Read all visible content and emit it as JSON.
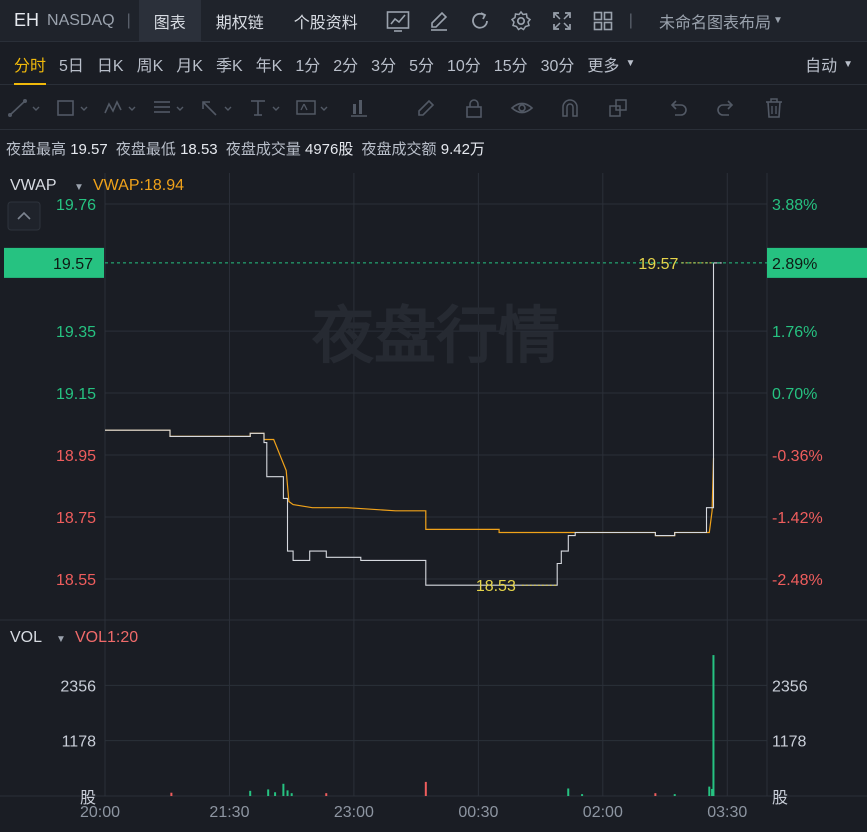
{
  "header": {
    "ticker": "EH",
    "exchange": "NASDAQ",
    "tabs": [
      "图表",
      "期权链",
      "个股资料"
    ],
    "layout_label": "未命名图表布局",
    "icons": [
      "indicator-icon",
      "draw-icon",
      "refresh-icon",
      "settings-icon",
      "fullscreen-icon",
      "grid-layout-icon"
    ]
  },
  "periods": {
    "items": [
      "分时",
      "5日",
      "日K",
      "周K",
      "月K",
      "季K",
      "年K",
      "1分",
      "2分",
      "3分",
      "5分",
      "10分",
      "15分",
      "30分"
    ],
    "more": "更多",
    "auto": "自动",
    "active": "分时"
  },
  "info": {
    "high_label": "夜盘最高",
    "high": "19.57",
    "low_label": "夜盘最低",
    "low": "18.53",
    "vol_label": "夜盘成交量",
    "vol": "4976股",
    "amt_label": "夜盘成交额",
    "amt": "9.42万"
  },
  "colors": {
    "up": "#26c281",
    "down": "#ef5d5d",
    "price_line": "#d6d9df",
    "vwap_line": "#f0a21a",
    "grid": "#2b3039",
    "background": "#1a1d24"
  },
  "chart_data": {
    "type": "line",
    "watermark": "夜盘行情",
    "main_indicator": "VWAP",
    "vwap_label": "VWAP:18.94",
    "y_ticks_left": [
      "19.76",
      "19.57",
      "19.35",
      "19.15",
      "18.95",
      "18.75",
      "18.55"
    ],
    "y_ticks_right": [
      "3.88%",
      "2.89%",
      "1.76%",
      "0.70%",
      "-0.36%",
      "-1.42%",
      "-2.48%"
    ],
    "current_price": "19.57",
    "current_pct": "2.89%",
    "high_marker": "19.57",
    "low_marker": "18.53",
    "x_ticks": [
      "20:00",
      "21:30",
      "23:00",
      "00:30",
      "02:00",
      "03:30"
    ],
    "ylim": [
      18.45,
      19.86
    ],
    "xlim_minutes": [
      0,
      450
    ],
    "series": [
      {
        "name": "price",
        "points": [
          [
            0,
            19.03
          ],
          [
            47,
            19.03
          ],
          [
            47,
            19.01
          ],
          [
            105,
            19.01
          ],
          [
            105,
            19.02
          ],
          [
            115,
            19.02
          ],
          [
            115,
            18.99
          ],
          [
            117,
            18.99
          ],
          [
            117,
            18.88
          ],
          [
            129,
            18.88
          ],
          [
            129,
            18.81
          ],
          [
            132,
            18.81
          ],
          [
            132,
            18.64
          ],
          [
            136,
            18.64
          ],
          [
            136,
            18.61
          ],
          [
            148,
            18.61
          ],
          [
            148,
            18.64
          ],
          [
            160,
            18.64
          ],
          [
            160,
            18.62
          ],
          [
            185,
            18.62
          ],
          [
            185,
            18.61
          ],
          [
            232,
            18.61
          ],
          [
            232,
            18.53
          ],
          [
            272,
            18.53
          ],
          [
            277,
            18.53
          ],
          [
            290,
            18.53
          ],
          [
            327,
            18.53
          ],
          [
            327,
            18.6
          ],
          [
            330,
            18.6
          ],
          [
            330,
            18.64
          ],
          [
            335,
            18.64
          ],
          [
            335,
            18.69
          ],
          [
            340,
            18.69
          ],
          [
            340,
            18.7
          ],
          [
            398,
            18.7
          ],
          [
            398,
            18.69
          ],
          [
            412,
            18.69
          ],
          [
            412,
            18.7
          ],
          [
            435,
            18.7
          ],
          [
            435,
            18.78
          ],
          [
            440,
            18.78
          ],
          [
            440,
            19.57
          ],
          [
            446,
            19.57
          ]
        ]
      },
      {
        "name": "vwap",
        "points": [
          [
            0,
            19.03
          ],
          [
            47,
            19.03
          ],
          [
            47,
            19.01
          ],
          [
            105,
            19.01
          ],
          [
            105,
            19.02
          ],
          [
            115,
            19.02
          ],
          [
            115,
            19.0
          ],
          [
            122,
            19.0
          ],
          [
            131,
            18.9
          ],
          [
            133,
            18.8
          ],
          [
            136,
            18.79
          ],
          [
            150,
            18.78
          ],
          [
            175,
            18.78
          ],
          [
            210,
            18.77
          ],
          [
            232,
            18.77
          ],
          [
            232,
            18.71
          ],
          [
            285,
            18.71
          ],
          [
            285,
            18.7
          ],
          [
            340,
            18.7
          ],
          [
            398,
            18.7
          ],
          [
            398,
            18.69
          ],
          [
            412,
            18.69
          ],
          [
            412,
            18.7
          ],
          [
            437,
            18.7
          ],
          [
            439,
            18.77
          ],
          [
            440,
            18.94
          ]
        ]
      }
    ],
    "volume": {
      "indicator": "VOL",
      "label": "VOL1:20",
      "y_ticks": [
        "2356",
        "1178"
      ],
      "y_unit": "股",
      "bars": [
        {
          "t": 48,
          "v": 70,
          "dir": "down"
        },
        {
          "t": 105,
          "v": 110,
          "dir": "up"
        },
        {
          "t": 118,
          "v": 140,
          "dir": "up"
        },
        {
          "t": 123,
          "v": 80,
          "dir": "up"
        },
        {
          "t": 129,
          "v": 260,
          "dir": "up"
        },
        {
          "t": 132,
          "v": 120,
          "dir": "up"
        },
        {
          "t": 135,
          "v": 60,
          "dir": "up"
        },
        {
          "t": 160,
          "v": 60,
          "dir": "down"
        },
        {
          "t": 232,
          "v": 300,
          "dir": "down"
        },
        {
          "t": 335,
          "v": 160,
          "dir": "up"
        },
        {
          "t": 345,
          "v": 40,
          "dir": "up"
        },
        {
          "t": 398,
          "v": 60,
          "dir": "down"
        },
        {
          "t": 412,
          "v": 40,
          "dir": "up"
        },
        {
          "t": 437,
          "v": 200,
          "dir": "up"
        },
        {
          "t": 439,
          "v": 150,
          "dir": "up"
        },
        {
          "t": 440,
          "v": 3000,
          "dir": "up"
        }
      ],
      "ylim": [
        0,
        3534
      ]
    }
  }
}
